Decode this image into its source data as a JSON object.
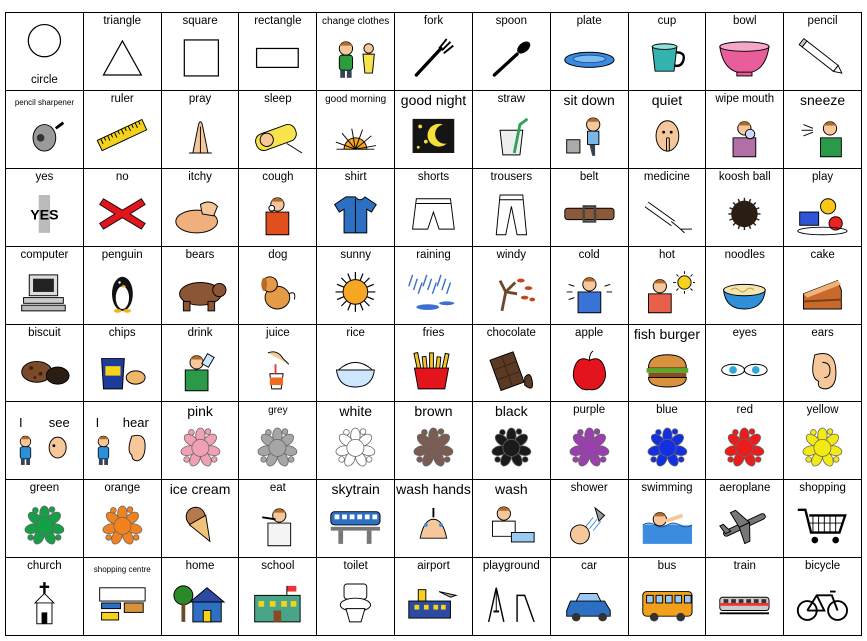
{
  "cells": [
    {
      "label": "circle",
      "icon": "circle-icon",
      "pos": "bottom"
    },
    {
      "label": "triangle",
      "icon": "triangle-icon"
    },
    {
      "label": "square",
      "icon": "square-icon"
    },
    {
      "label": "rectangle",
      "icon": "rectangle-icon"
    },
    {
      "label": "change clothes",
      "icon": "change-clothes-icon",
      "size": "small"
    },
    {
      "label": "fork",
      "icon": "fork-icon"
    },
    {
      "label": "spoon",
      "icon": "spoon-icon"
    },
    {
      "label": "plate",
      "icon": "plate-icon"
    },
    {
      "label": "cup",
      "icon": "cup-icon"
    },
    {
      "label": "bowl",
      "icon": "bowl-icon"
    },
    {
      "label": "pencil",
      "icon": "pencil-icon"
    },
    {
      "label": "pencil sharpener",
      "icon": "pencil-sharpener-icon",
      "size": "tiny"
    },
    {
      "label": "ruler",
      "icon": "ruler-icon"
    },
    {
      "label": "pray",
      "icon": "pray-icon"
    },
    {
      "label": "sleep",
      "icon": "sleep-icon"
    },
    {
      "label": "good morning",
      "icon": "sunrise-icon",
      "size": "small"
    },
    {
      "label": "good night",
      "icon": "moon-stars-icon",
      "size": "big"
    },
    {
      "label": "straw",
      "icon": "straw-icon"
    },
    {
      "label": "sit down",
      "icon": "sit-down-icon",
      "size": "big"
    },
    {
      "label": "quiet",
      "icon": "quiet-icon",
      "size": "big"
    },
    {
      "label": "wipe mouth",
      "icon": "wipe-mouth-icon"
    },
    {
      "label": "sneeze",
      "icon": "sneeze-icon",
      "size": "big"
    },
    {
      "label": "yes",
      "icon": "yes-icon",
      "yes_text": "YES"
    },
    {
      "label": "no",
      "icon": "red-x-icon"
    },
    {
      "label": "itchy",
      "icon": "itchy-icon"
    },
    {
      "label": "cough",
      "icon": "cough-icon"
    },
    {
      "label": "shirt",
      "icon": "shirt-icon"
    },
    {
      "label": "shorts",
      "icon": "shorts-icon"
    },
    {
      "label": "trousers",
      "icon": "trousers-icon"
    },
    {
      "label": "belt",
      "icon": "belt-icon"
    },
    {
      "label": "medicine",
      "icon": "medicine-icon"
    },
    {
      "label": "koosh ball",
      "icon": "koosh-ball-icon"
    },
    {
      "label": "play",
      "icon": "toys-icon"
    },
    {
      "label": "computer",
      "icon": "computer-icon"
    },
    {
      "label": "penguin",
      "icon": "penguin-icon"
    },
    {
      "label": "bears",
      "icon": "bear-icon"
    },
    {
      "label": "dog",
      "icon": "dog-icon"
    },
    {
      "label": "sunny",
      "icon": "sun-icon"
    },
    {
      "label": "raining",
      "icon": "rain-icon"
    },
    {
      "label": "windy",
      "icon": "windy-tree-icon"
    },
    {
      "label": "cold",
      "icon": "cold-icon"
    },
    {
      "label": "hot",
      "icon": "hot-icon"
    },
    {
      "label": "noodles",
      "icon": "noodles-icon"
    },
    {
      "label": "cake",
      "icon": "cake-icon"
    },
    {
      "label": "biscuit",
      "icon": "biscuit-icon"
    },
    {
      "label": "chips",
      "icon": "chips-icon"
    },
    {
      "label": "drink",
      "icon": "drink-icon"
    },
    {
      "label": "juice",
      "icon": "juice-icon"
    },
    {
      "label": "rice",
      "icon": "rice-icon"
    },
    {
      "label": "fries",
      "icon": "fries-icon"
    },
    {
      "label": "chocolate",
      "icon": "chocolate-icon"
    },
    {
      "label": "apple",
      "icon": "apple-icon"
    },
    {
      "label": "fish burger",
      "icon": "burger-icon",
      "size": "big"
    },
    {
      "label": "eyes",
      "icon": "eyes-icon"
    },
    {
      "label": "ears",
      "icon": "ear-icon"
    },
    {
      "label": "I see",
      "icon": "i-see-icon",
      "split": [
        "I",
        "see"
      ]
    },
    {
      "label": "I hear",
      "icon": "i-hear-icon",
      "split": [
        "I",
        "hear"
      ]
    },
    {
      "label": "pink",
      "icon": "splat-icon",
      "color": "#f2a0b4",
      "size": "big"
    },
    {
      "label": "grey",
      "icon": "splat-icon",
      "color": "#a6a6a6",
      "size": "small"
    },
    {
      "label": "white",
      "icon": "splat-icon",
      "color": "#ffffff",
      "size": "big"
    },
    {
      "label": "brown",
      "icon": "splat-icon",
      "color": "#7a5c52",
      "size": "big"
    },
    {
      "label": "black",
      "icon": "splat-icon",
      "color": "#1a1a1a",
      "size": "big"
    },
    {
      "label": "purple",
      "icon": "splat-icon",
      "color": "#9b3fb0"
    },
    {
      "label": "blue",
      "icon": "splat-icon",
      "color": "#1230e0"
    },
    {
      "label": "red",
      "icon": "splat-icon",
      "color": "#ea1c1c"
    },
    {
      "label": "yellow",
      "icon": "splat-icon",
      "color": "#f3ea14"
    },
    {
      "label": "green",
      "icon": "splat-icon",
      "color": "#13a046"
    },
    {
      "label": "orange",
      "icon": "splat-icon",
      "color": "#f2821e"
    },
    {
      "label": "ice cream",
      "icon": "ice-cream-icon",
      "size": "big"
    },
    {
      "label": "eat",
      "icon": "eat-icon"
    },
    {
      "label": "skytrain",
      "icon": "skytrain-icon",
      "size": "big"
    },
    {
      "label": "wash hands",
      "icon": "wash-hands-icon",
      "size": "big"
    },
    {
      "label": "wash",
      "icon": "wash-icon",
      "size": "big"
    },
    {
      "label": "shower",
      "icon": "shower-icon"
    },
    {
      "label": "swimming",
      "icon": "swimming-icon"
    },
    {
      "label": "aeroplane",
      "icon": "aeroplane-icon"
    },
    {
      "label": "shopping",
      "icon": "shopping-cart-icon"
    },
    {
      "label": "church",
      "icon": "church-icon"
    },
    {
      "label": "shopping centre",
      "icon": "shopping-centre-icon",
      "size": "tiny"
    },
    {
      "label": "home",
      "icon": "house-icon"
    },
    {
      "label": "school",
      "icon": "school-icon"
    },
    {
      "label": "toilet",
      "icon": "toilet-icon"
    },
    {
      "label": "airport",
      "icon": "airport-icon"
    },
    {
      "label": "playground",
      "icon": "playground-icon"
    },
    {
      "label": "car",
      "icon": "car-icon"
    },
    {
      "label": "bus",
      "icon": "bus-icon"
    },
    {
      "label": "train",
      "icon": "train-icon"
    },
    {
      "label": "bicycle",
      "icon": "bicycle-icon"
    }
  ]
}
